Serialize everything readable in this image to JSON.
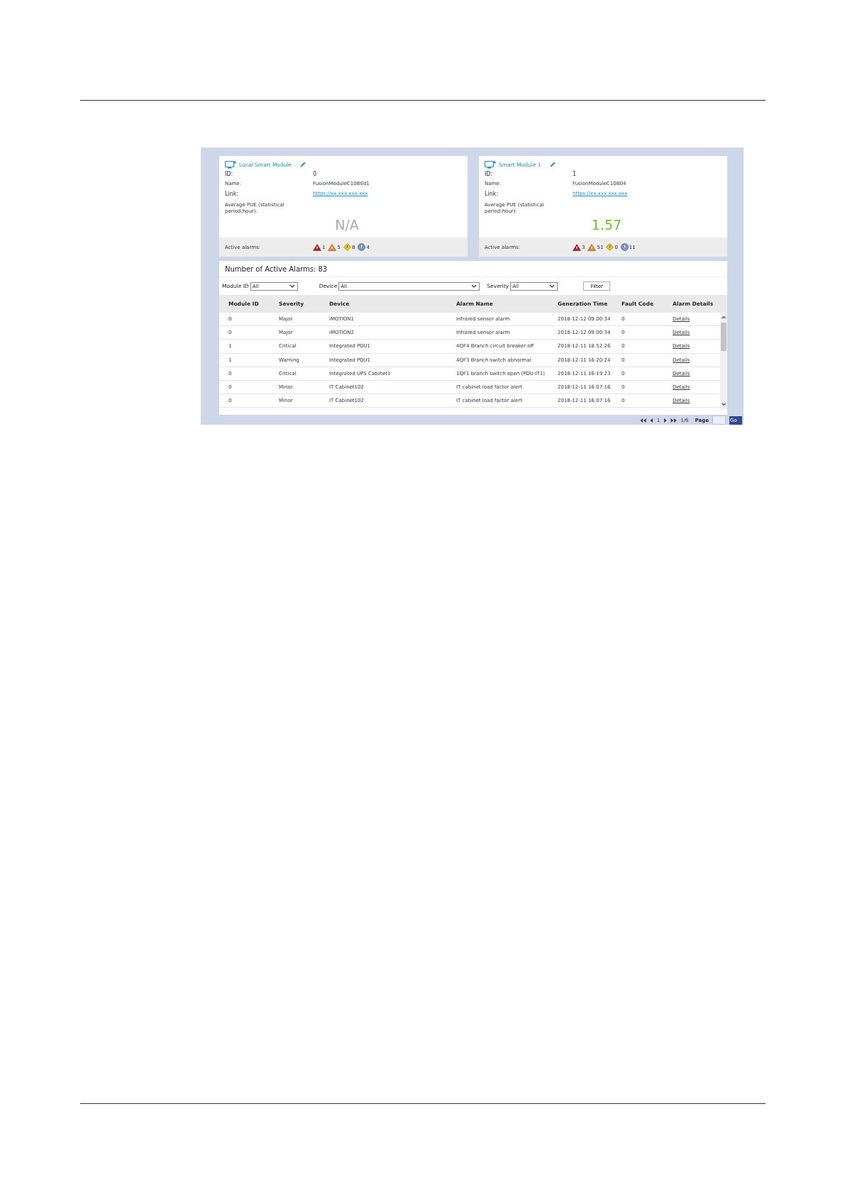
{
  "modules": [
    {
      "title": "Local Smart Module",
      "id_label": "ID:",
      "id": "0",
      "name_label": "Name:",
      "name": "FusionModuleC10B0d1",
      "link_label": "Link:",
      "link": "https://xx.xxx.xxx.xxx",
      "pue_label": "Average PUE (statistical period:hour):",
      "pue": "N/A",
      "pue_available": false,
      "alarms_label": "Active alarms:",
      "alarms": [
        {
          "kind": "critical",
          "count": "1"
        },
        {
          "kind": "major",
          "count": "5"
        },
        {
          "kind": "minor",
          "count": "8"
        },
        {
          "kind": "warning",
          "count": "4"
        }
      ]
    },
    {
      "title": "Smart Module 1",
      "id_label": "ID:",
      "id": "1",
      "name_label": "Name:",
      "name": "FusionModuleC10B04",
      "link_label": "Link:",
      "link": "https://xx.xxx.xxx.xxx",
      "pue_label": "Average PUE (statistical period:hour):",
      "pue": "1.57",
      "pue_available": true,
      "alarms_label": "Active alarms:",
      "alarms": [
        {
          "kind": "critical",
          "count": "3"
        },
        {
          "kind": "major",
          "count": "51"
        },
        {
          "kind": "minor",
          "count": "0"
        },
        {
          "kind": "warning",
          "count": "11"
        }
      ]
    }
  ],
  "alarm_count": "Number of Active Alarms: 83",
  "filters": [
    {
      "label": "Module ID",
      "value": "All",
      "kind": "short"
    },
    {
      "label": "Device",
      "value": "All",
      "kind": "wide"
    },
    {
      "label": "Severity",
      "value": "All",
      "kind": "short"
    }
  ],
  "filter_button": "Filter",
  "table": {
    "columns": [
      "Module ID",
      "Severity",
      "Device",
      "Alarm Name",
      "Generation Time",
      "Fault Code",
      "Alarm Details"
    ],
    "rows": [
      [
        "0",
        "Major",
        "iMOTION1",
        "Infrared sensor alarm",
        "2018-12-12 09:00:34",
        "0",
        "Details"
      ],
      [
        "0",
        "Major",
        "iMOTION2",
        "Infrared sensor alarm",
        "2018-12-12 09:00:34",
        "0",
        "Details"
      ],
      [
        "1",
        "Critical",
        "Integrated PDU1",
        "4QF4 Branch circuit breaker off",
        "2018-12-11 18:52:26",
        "0",
        "Details"
      ],
      [
        "1",
        "Warning",
        "Integrated PDU1",
        "4QF3 Branch switch abnormal",
        "2018-12-11 16:20:24",
        "0",
        "Details"
      ],
      [
        "0",
        "Critical",
        "Integrated UPS Cabinet1",
        "1QF1 branch switch open (PDU-IT1)",
        "2018-12-11 16:19:23",
        "0",
        "Details"
      ],
      [
        "0",
        "Minor",
        "IT Cabinet102",
        "IT cabinet load factor alert",
        "2018-12-11 16:07:16",
        "0",
        "Details"
      ],
      [
        "0",
        "Minor",
        "IT Cabinet102",
        "IT cabinet load factor alert",
        "2018-12-11 16:07:16",
        "0",
        "Details"
      ]
    ]
  },
  "pager": {
    "page": "1",
    "total": "1/6",
    "page_label": "Page",
    "go": "Go"
  }
}
